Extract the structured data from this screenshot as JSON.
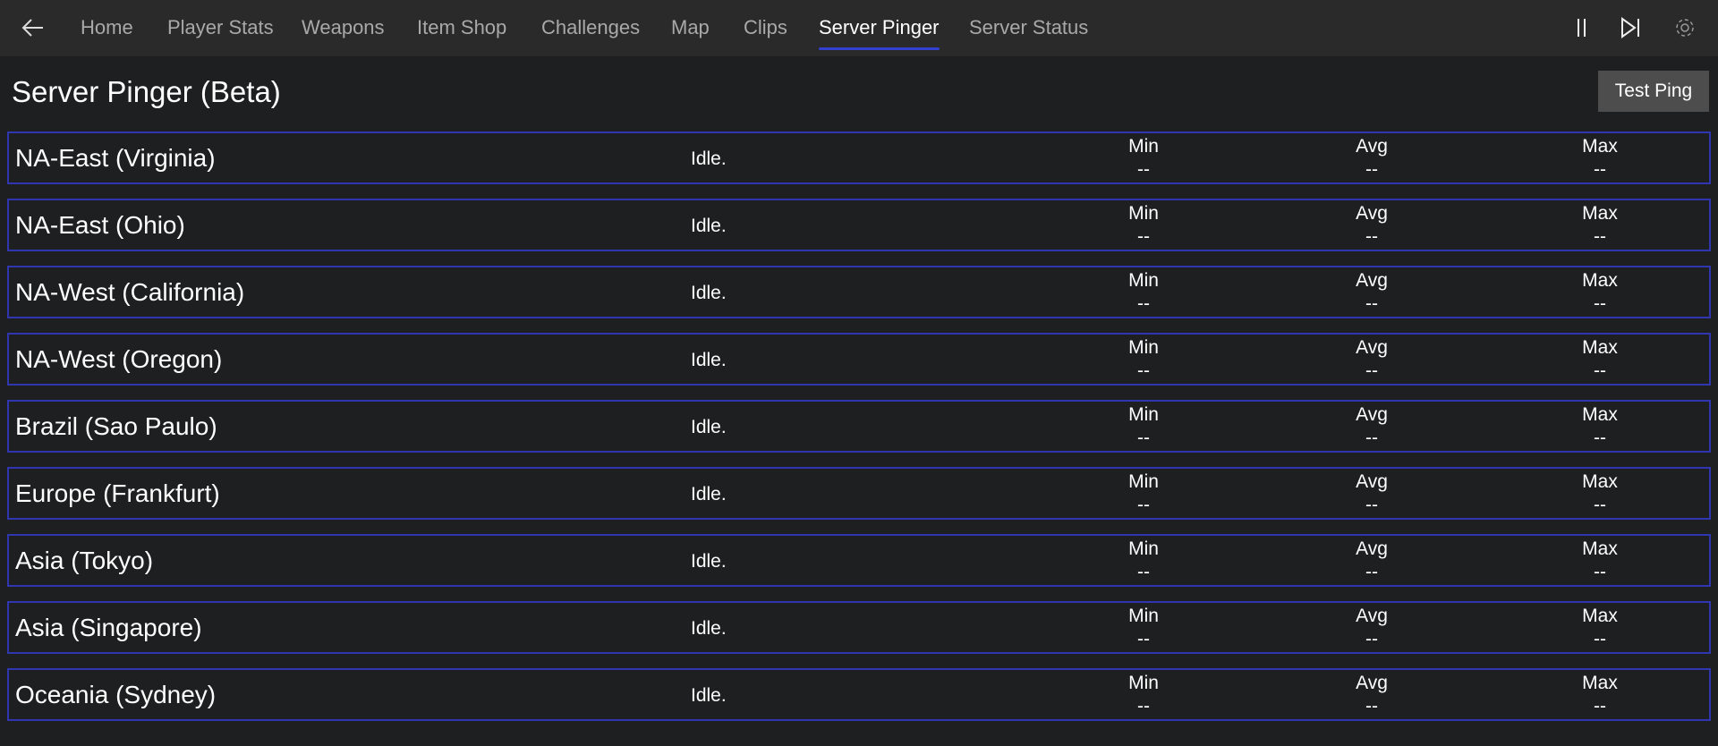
{
  "nav": {
    "tabs": [
      "Home",
      "Player Stats",
      "Weapons",
      "Item Shop",
      "Challenges",
      "Map",
      "Clips",
      "Server Pinger",
      "Server Status"
    ],
    "active_tab": "Server Pinger",
    "icons": [
      "back-arrow-icon",
      "pause-icon",
      "skip-next-icon",
      "gear-icon"
    ]
  },
  "page": {
    "title": "Server Pinger (Beta)",
    "test_ping_label": "Test Ping"
  },
  "columns": {
    "min": "Min",
    "avg": "Avg",
    "max": "Max"
  },
  "servers": [
    {
      "name": "NA-East (Virginia)",
      "status": "Idle.",
      "min": "--",
      "avg": "--",
      "max": "--"
    },
    {
      "name": "NA-East (Ohio)",
      "status": "Idle.",
      "min": "--",
      "avg": "--",
      "max": "--"
    },
    {
      "name": "NA-West (California)",
      "status": "Idle.",
      "min": "--",
      "avg": "--",
      "max": "--"
    },
    {
      "name": "NA-West (Oregon)",
      "status": "Idle.",
      "min": "--",
      "avg": "--",
      "max": "--"
    },
    {
      "name": "Brazil (Sao Paulo)",
      "status": "Idle.",
      "min": "--",
      "avg": "--",
      "max": "--"
    },
    {
      "name": "Europe (Frankfurt)",
      "status": "Idle.",
      "min": "--",
      "avg": "--",
      "max": "--"
    },
    {
      "name": "Asia (Tokyo)",
      "status": "Idle.",
      "min": "--",
      "avg": "--",
      "max": "--"
    },
    {
      "name": "Asia (Singapore)",
      "status": "Idle.",
      "min": "--",
      "avg": "--",
      "max": "--"
    },
    {
      "name": "Oceania (Sydney)",
      "status": "Idle.",
      "min": "--",
      "avg": "--",
      "max": "--"
    }
  ],
  "colors": {
    "accent": "#3340d0",
    "row_border": "#2f36b0",
    "nav_bg": "#2a2a2a",
    "bg": "#1e1f20",
    "button_bg": "#4d4d4d"
  }
}
